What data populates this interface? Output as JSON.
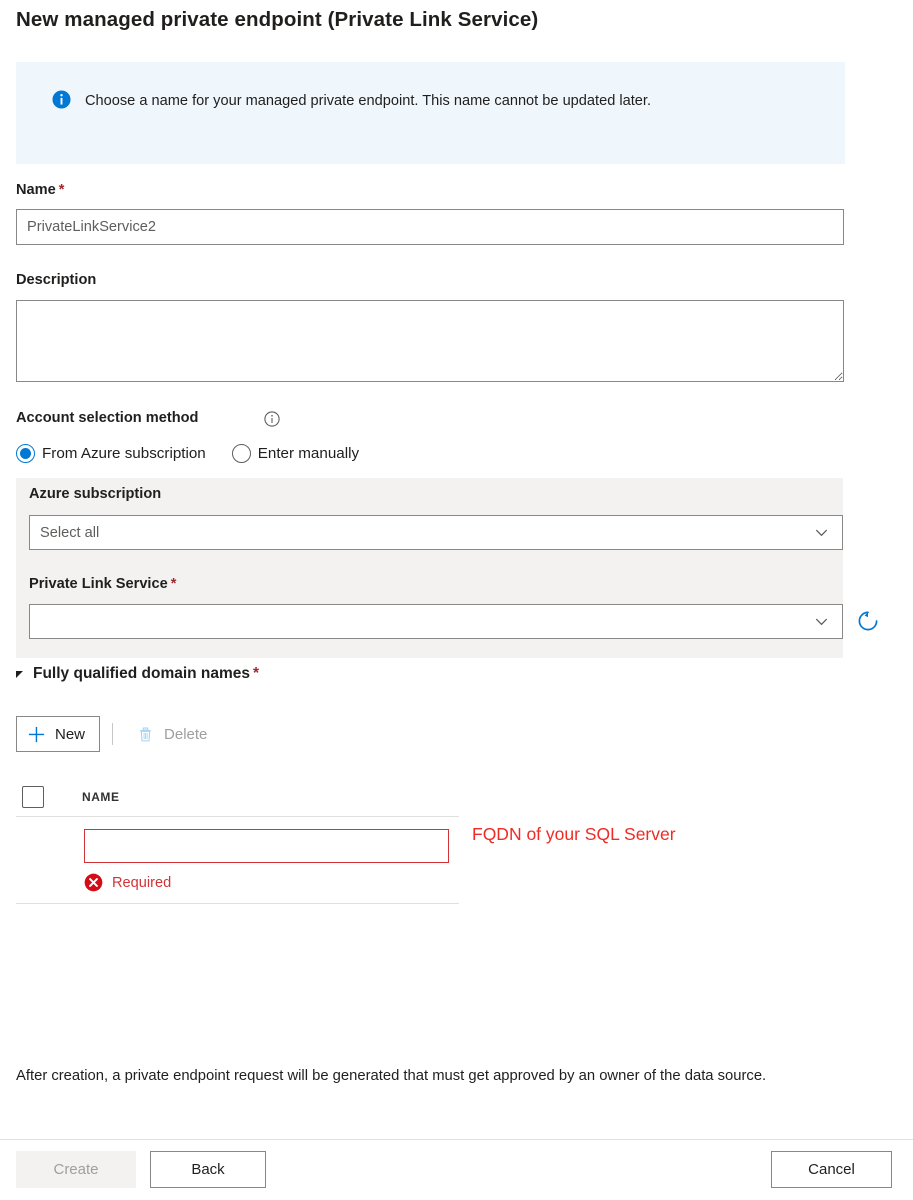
{
  "page_title": "New managed private endpoint (Private Link Service)",
  "info_banner": {
    "icon": "info-circle-icon",
    "text": "Choose a name for your managed private endpoint. This name cannot be updated later.",
    "background_color": "#eff6fc"
  },
  "name_field": {
    "label": "Name",
    "required_marker": "*",
    "value": "PrivateLinkService2",
    "placeholder": "PrivateLinkService2"
  },
  "description_field": {
    "label": "Description",
    "value": "",
    "placeholder": ""
  },
  "account_selection": {
    "label": "Account selection method",
    "info_icon": "info-outline-icon",
    "options": [
      {
        "label": "From Azure subscription",
        "selected": true
      },
      {
        "label": "Enter manually",
        "selected": false
      }
    ]
  },
  "azure_subscription": {
    "label": "Azure subscription",
    "selected_value": "Select all",
    "chevron_icon": "chevron-down-icon"
  },
  "private_link_service": {
    "label": "Private Link Service",
    "required_marker": "*",
    "selected_value": "",
    "chevron_icon": "chevron-down-icon",
    "refresh_icon": "refresh-icon",
    "refresh_color": "#0078d4"
  },
  "fqdn_section": {
    "title": "Fully qualified domain names",
    "required_marker": "*",
    "expanded": true,
    "toolbar": {
      "new_label": "New",
      "new_icon": "plus-icon",
      "delete_label": "Delete",
      "delete_icon": "trash-icon",
      "delete_disabled": true
    },
    "table": {
      "select_all_checkbox": "select-all-checkbox",
      "columns": [
        "NAME"
      ],
      "rows": [
        {
          "name_value": "",
          "error_icon": "error-circle-icon",
          "error_text": "Required"
        }
      ]
    }
  },
  "annotation": {
    "text": "FQDN of your SQL Server",
    "color": "#ee2b24"
  },
  "footer_note": "After creation, a private endpoint request will be generated that must get approved by an owner of the data source.",
  "actions": {
    "create_label": "Create",
    "create_disabled": true,
    "back_label": "Back",
    "cancel_label": "Cancel"
  },
  "theme": {
    "accent": "#0078d4",
    "error": "#d13438",
    "required_star": "#a4262c",
    "panel_bg": "#f3f2f1",
    "border": "#8a8886"
  }
}
